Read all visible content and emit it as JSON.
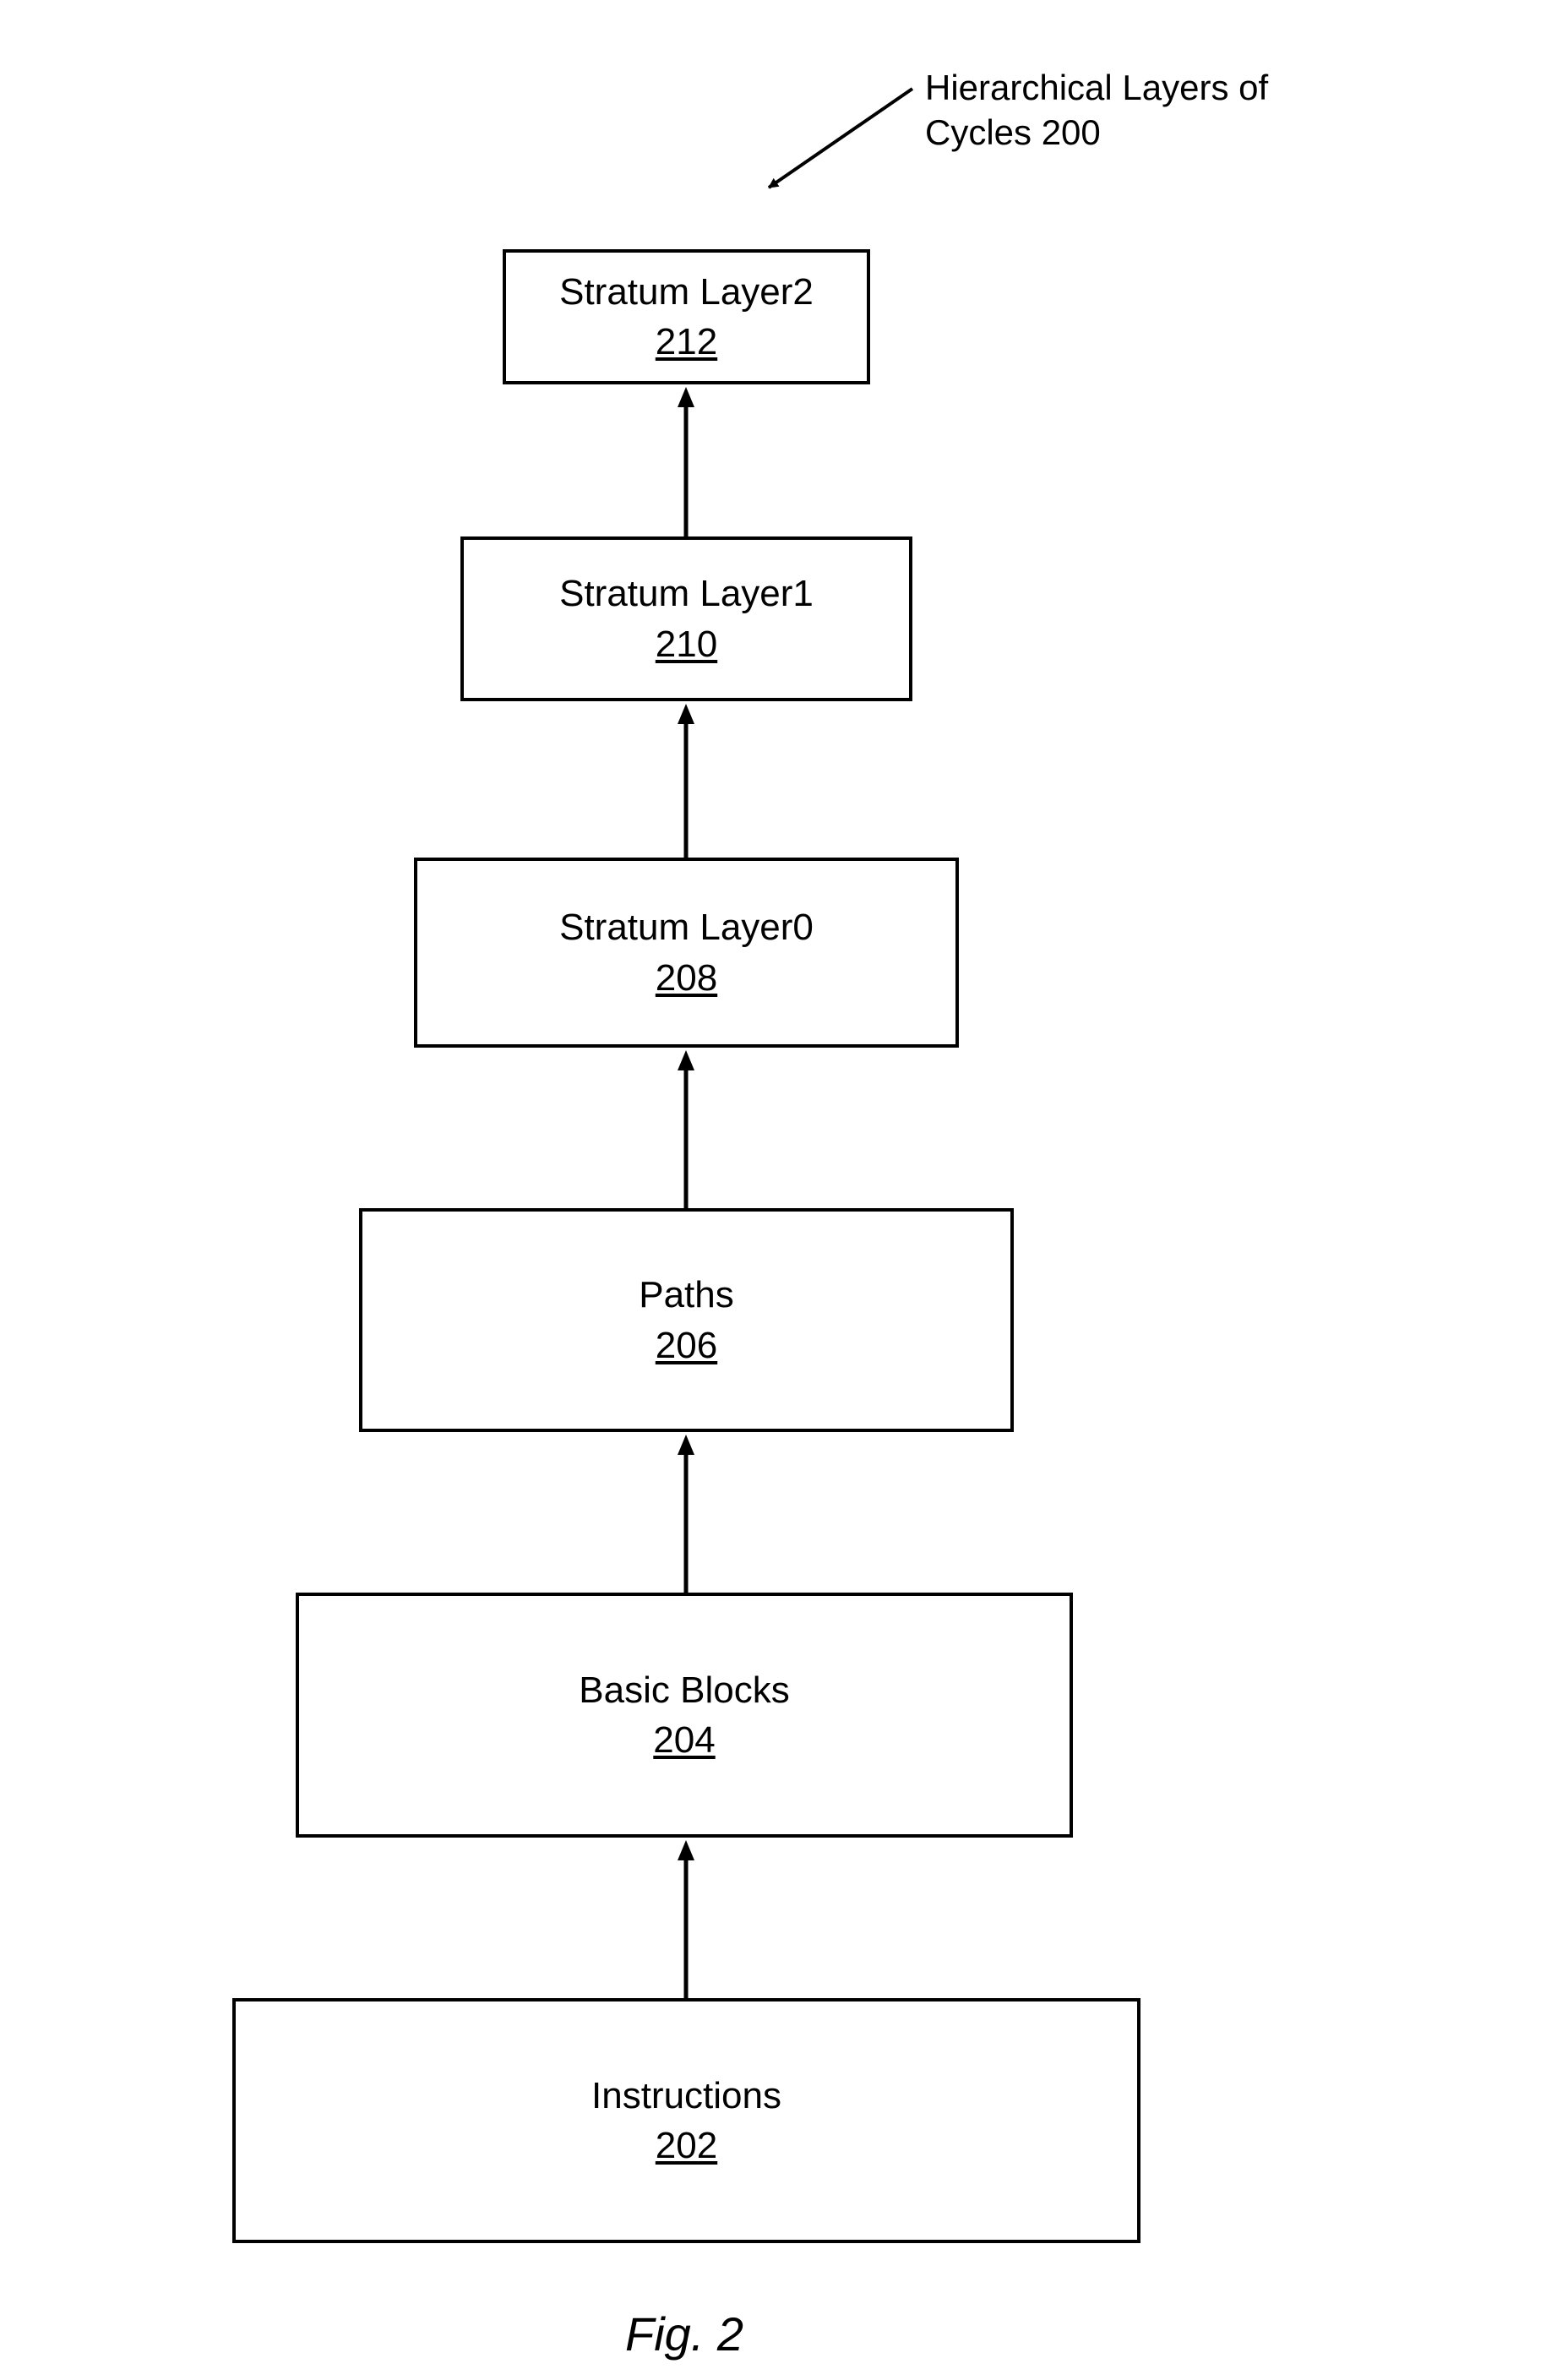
{
  "annotation": {
    "line1": "Hierarchical Layers of",
    "line2": "Cycles 200"
  },
  "boxes": {
    "stratum2": {
      "title": "Stratum Layer2",
      "ref": "212"
    },
    "stratum1": {
      "title": "Stratum Layer1",
      "ref": "210"
    },
    "stratum0": {
      "title": "Stratum Layer0",
      "ref": "208"
    },
    "paths": {
      "title": "Paths",
      "ref": "206"
    },
    "blocks": {
      "title": "Basic Blocks",
      "ref": "204"
    },
    "instr": {
      "title": "Instructions",
      "ref": "202"
    }
  },
  "figure_caption": "Fig. 2"
}
